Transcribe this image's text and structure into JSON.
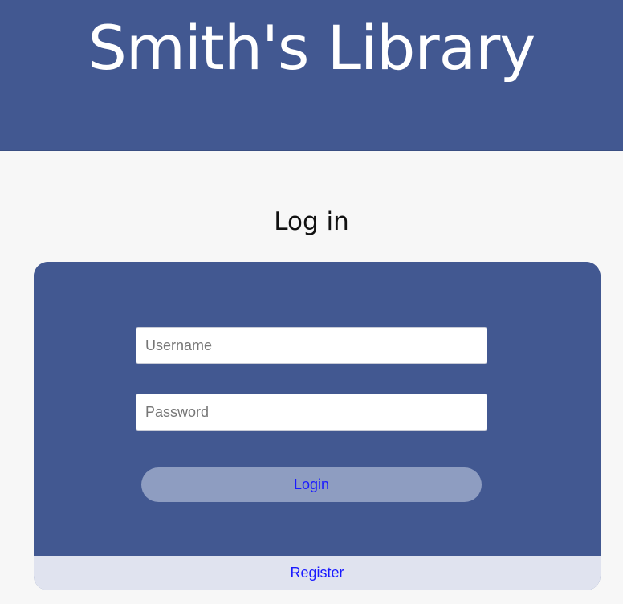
{
  "header": {
    "title": "Smith's Library"
  },
  "main": {
    "heading": "Log in"
  },
  "login_form": {
    "username_placeholder": "Username",
    "username_value": "",
    "password_placeholder": "Password",
    "password_value": "",
    "login_label": "Login",
    "register_label": "Register"
  },
  "colors": {
    "brand": "#425891",
    "background": "#f7f7f7",
    "button": "#8e9dc1",
    "footer": "#e0e3ef",
    "link": "#1a1aff"
  }
}
